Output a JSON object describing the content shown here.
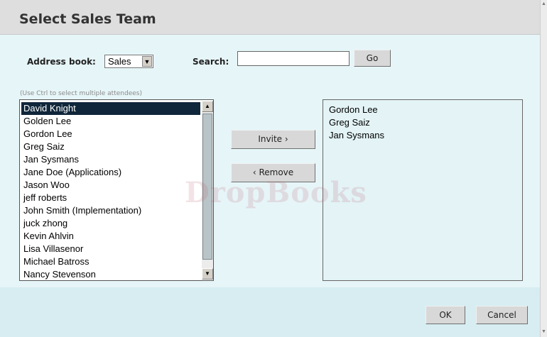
{
  "dialog": {
    "title": "Select Sales Team"
  },
  "address_book": {
    "label": "Address book:",
    "selected": "Sales"
  },
  "search": {
    "label": "Search:",
    "value": "",
    "go_label": "Go"
  },
  "hint": "(Use Ctrl to select multiple attendees)",
  "available": {
    "items": [
      "David Knight",
      "Golden Lee",
      "Gordon Lee",
      "Greg Saiz",
      "Jan Sysmans",
      "Jane Doe (Applications)",
      "Jason Woo",
      "jeff roberts",
      "John Smith (Implementation)",
      "juck zhong",
      "Kevin Ahlvin",
      "Lisa Villasenor",
      "Michael Batross",
      "Nancy Stevenson"
    ],
    "selected_index": 0
  },
  "actions": {
    "invite_label": "Invite ›",
    "remove_label": "‹ Remove"
  },
  "selected": {
    "items": [
      "Gordon Lee",
      "Greg Saiz",
      "Jan Sysmans"
    ]
  },
  "footer": {
    "ok_label": "OK",
    "cancel_label": "Cancel"
  },
  "watermark": "DropBooks",
  "icons": {
    "dropdown": "chevron-down-icon",
    "scroll_up": "scroll-up-icon",
    "scroll_down": "scroll-down-icon"
  },
  "colors": {
    "selected_row_bg": "#10263a",
    "dialog_bg": "#e6f5f8",
    "title_bg": "#dedede"
  }
}
